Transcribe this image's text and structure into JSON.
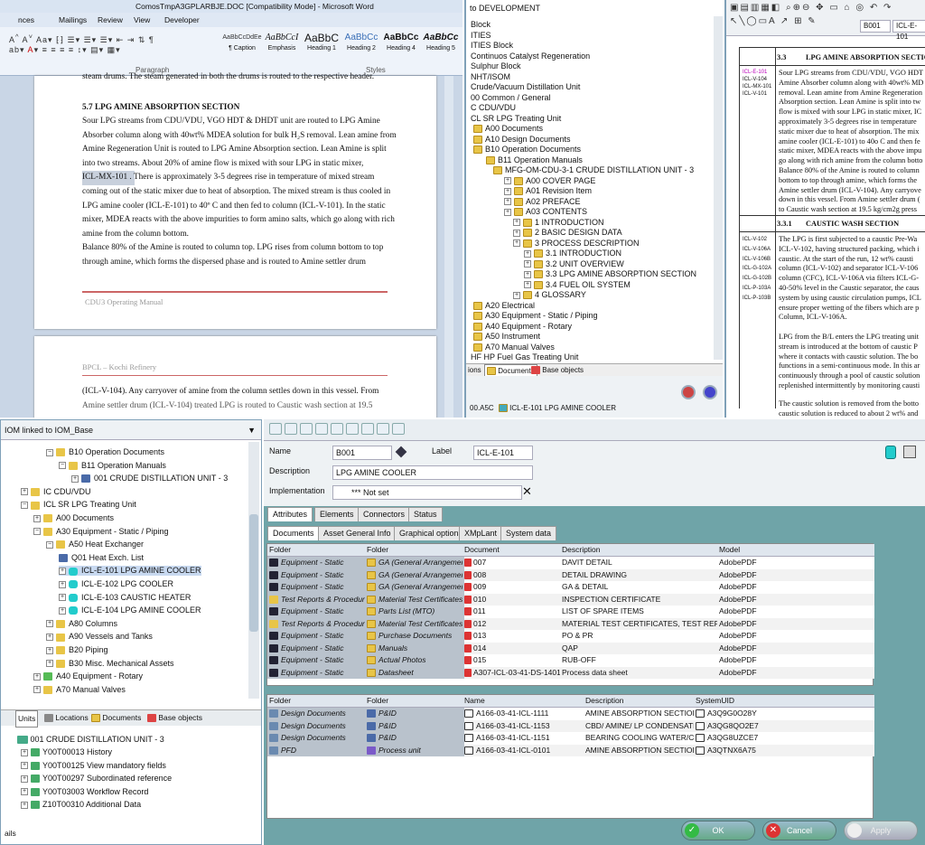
{
  "word": {
    "title": "ComosTmpA3GPLARBJE.DOC [Compatibility Mode] - Microsoft Word",
    "tabs": [
      "nces",
      "Mailings",
      "Review",
      "View",
      "Developer"
    ],
    "styles": [
      {
        "preview": "AaBbCcDdEe",
        "name": "¶ Caption"
      },
      {
        "preview": "AaBbCcI",
        "name": "Emphasis"
      },
      {
        "preview": "AaBbC",
        "name": "Heading 1"
      },
      {
        "preview": "AaBbCc",
        "name": "Heading 2"
      },
      {
        "preview": "AaBbCc",
        "name": "Heading 4"
      },
      {
        "preview": "AaBbCc",
        "name": "Heading 5"
      }
    ],
    "group_paragraph": "Paragraph",
    "group_styles": "Styles",
    "top_line": "steam drums. The steam generated in both the drums is routed to the respective header.",
    "heading": "5.7 LPG AMINE ABSORPTION SECTION",
    "body_lines": [
      "Sour LPG streams from CDU/VDU, VGO HDT & DHDT unit are routed to LPG Amine",
      "Absorber column along with 40wt% MDEA solution for bulk H₂S removal. Lean amine from",
      "Amine Regeneration Unit is routed to LPG Amine Absorption section. Lean Amine is split",
      "into two streams. About 20% of amine flow is mixed with sour LPG in static mixer,",
      "ICL-MX-101 . There is approximately 3-5 degrees rise in temperature of mixed stream",
      "coming out of the static mixer due to heat of absorption. The mixed stream is thus cooled in",
      "LPG amine cooler (ICL-E-101) to 40º C and then fed to column (ICL-V-101). In the static",
      "mixer, MDEA reacts with the above impurities to form amino salts, which go along with rich",
      "amine from the column bottom.",
      "Balance 80% of the Amine is routed to column top. LPG rises from column bottom to top",
      "through amine, which forms the dispersed phase and is routed to Amine settler drum"
    ],
    "footer": "CDU3 Operating Manual",
    "page2_header": "BPCL – Kochi Refinery",
    "page2_line1": "(ICL-V-104). Any carryover of amine from the column settles down in this vessel. From",
    "page2_line2": "Amine settler drum (ICL-V-104) treated LPG is routed to Caustic wash section at 19.5"
  },
  "tree_top": {
    "title": "to DEVELOPMENT",
    "items": [
      "Block",
      "ITIES",
      "ITIES  Block",
      "Continuos Catalyst Regeneration",
      "Sulphur Block",
      "NHT/ISOM",
      "Crude/Vacuum Distillation Unit",
      "00   Common / General",
      "C    CDU/VDU",
      "CL   SR LPG Treating Unit",
      "A00   Documents",
      "A10   Design Documents",
      "B10   Operation Documents",
      "B11   Operation Manuals",
      "MFG-OM-CDU-3-1  CRUDE DISTILLATION UNIT - 3",
      "A00   COVER PAGE",
      "A01   Revision Item",
      "A02   PREFACE",
      "A03   CONTENTS",
      "1     INTRODUCTION",
      "2     BASIC DESIGN DATA",
      "3     PROCESS DESCRIPTION",
      "3.1   INTRODUCTION",
      "3.2   UNIT OVERVIEW",
      "3.3   LPG AMINE ABSORPTION SECTION",
      "3.4   FUEL OIL SYSTEM",
      "4     GLOSSARY",
      "A20   Electrical",
      "A30   Equipment - Static / Piping",
      "A40   Equipment - Rotary",
      "A50   Instrument",
      "A70   Manual Valves",
      "HF   HP Fuel Gas Treating Unit"
    ],
    "tabs": [
      "ions",
      "Documents",
      "Base objects"
    ],
    "status": "00.A5C",
    "status_item": "ICL-E-101 LPG AMINE COOLER"
  },
  "viewer": {
    "field1": "B001",
    "field2": "ICL-E-101",
    "sec1_num": "3.3",
    "sec1_title": "LPG AMINE ABSORPTION SECTION",
    "sec1_tags": [
      "ICL-E-101",
      "ICL-V-104",
      "ICL-MX-101",
      "ICL-V-101"
    ],
    "sec1_lines": [
      "Sour LPG streams from CDU/VDU, VGO HDT",
      "Amine Absorber column along with 40wt% MD",
      "removal. Lean amine from Amine Regeneration",
      "Absorption section. Lean Amine is split into tw",
      "flow is mixed with sour LPG in static mixer, IC",
      "approximately 3-5 degrees rise in temperature",
      "static mixer due to heat of absorption. The mix",
      "amine cooler (ICL-E-101) to 40o C and then fe",
      "static mixer, MDEA reacts with the above impu",
      "go along with rich amine from the column botto",
      "Balance 80% of the Amine is routed to column",
      "bottom to top through amine, which forms the",
      "Amine settler drum (ICL-V-104). Any carryove",
      "down in this vessel. From Amine settler drum (",
      "to Caustic wash section at 19.5 kg/cm2g press"
    ],
    "sec2_num": "3.3.1",
    "sec2_title": "CAUSTIC WASH SECTION",
    "sec2_tags": [
      "ICL-V-102",
      "ICL-V-106A",
      "ICL-V-106B",
      "ICL-G-102A",
      "ICL-G-102B",
      "ICL-P-103A",
      "ICL-P-103B"
    ],
    "sec2_lines": [
      "The LPG is first subjected to a caustic Pre-Wa",
      "ICL-V-102, having structured packing, which i",
      "caustic. At the start of the run, 12 wt% causti",
      "column (ICL-V-102) and separator ICL-V-106",
      "column (CFC), ICL-V-106A via filters ICL-G-",
      "40-50% level in the Caustic separator, the caus",
      "system by using caustic circulation pumps, ICL",
      "ensure proper wetting of the fibers which are p",
      "Column, ICL-V-106A."
    ],
    "para3": [
      "LPG from the B/L enters the LPG treating unit",
      "stream is introduced at the bottom of caustic P",
      "where it contacts with caustic solution. The bo",
      "functions in a semi-continuous mode. In this ar",
      "continuously through a pool of caustic solution",
      "replenished intermittently by monitoring causti"
    ],
    "para4": [
      "The caustic solution is removed from the botto",
      "caustic solution is reduced to about 2 wt% and"
    ]
  },
  "tree_bottom": {
    "title": "IOM   linked to IOM_Base",
    "items": [
      {
        "t": "B10   Operation Documents",
        "ind": 70,
        "e": "−",
        "i": "fold"
      },
      {
        "t": "B11   Operation Manuals",
        "ind": 84,
        "e": "−",
        "i": "fold"
      },
      {
        "t": "001   CRUDE DISTILLATION UNIT - 3",
        "ind": 98,
        "e": "+",
        "i": "doc"
      },
      {
        "t": "IC   CDU/VDU",
        "ind": 42,
        "e": "+",
        "i": "fold"
      },
      {
        "t": "ICL   SR LPG Treating Unit",
        "ind": 42,
        "e": "−",
        "i": "fold"
      },
      {
        "t": "A00   Documents",
        "ind": 56,
        "e": "+",
        "i": "fold"
      },
      {
        "t": "A30   Equipment - Static / Piping",
        "ind": 56,
        "e": "−",
        "i": "fold"
      },
      {
        "t": "A50   Heat Exchanger",
        "ind": 70,
        "e": "−",
        "i": "fold"
      },
      {
        "t": "Q01   Heat Exch. List",
        "ind": 84,
        "e": "",
        "i": "doc"
      },
      {
        "t": "ICL-E-101   LPG AMINE COOLER",
        "ind": 84,
        "e": "+",
        "i": "eq"
      },
      {
        "t": "ICL-E-102   LPG COOLER",
        "ind": 84,
        "e": "+",
        "i": "eq"
      },
      {
        "t": "ICL-E-103   CAUSTIC HEATER",
        "ind": 84,
        "e": "+",
        "i": "eq"
      },
      {
        "t": "ICL-E-104   LPG AMINE COOLER",
        "ind": 84,
        "e": "+",
        "i": "eq"
      },
      {
        "t": "A80   Columns",
        "ind": 70,
        "e": "+",
        "i": "fold"
      },
      {
        "t": "A90   Vessels and Tanks",
        "ind": 70,
        "e": "+",
        "i": "fold"
      },
      {
        "t": "B20   Piping",
        "ind": 70,
        "e": "+",
        "i": "fold"
      },
      {
        "t": "B30   Misc. Mechanical Assets",
        "ind": 70,
        "e": "+",
        "i": "fold"
      },
      {
        "t": "A40   Equipment - Rotary",
        "ind": 56,
        "e": "+",
        "i": "rot"
      },
      {
        "t": "A70   Manual Valves",
        "ind": 56,
        "e": "+",
        "i": "fold"
      }
    ],
    "tabs": [
      "Units",
      "Locations",
      "Documents",
      "Base objects"
    ],
    "props_title": "001  CRUDE DISTILLATION UNIT - 3",
    "props": [
      "Y00T00013   History",
      "Y00T00125   View mandatory fields",
      "Y00T00297   Subordinated reference",
      "Y00T03003   Workflow Record",
      "Z10T00310   Additional Data"
    ],
    "bottom_tab": "ails"
  },
  "props": {
    "name_label": "Name",
    "name_value": "B001",
    "label_label": "Label",
    "label_value": "ICL-E-101",
    "desc_label": "Description",
    "desc_value": "LPG AMINE COOLER",
    "impl_label": "Implementation",
    "impl_value": "*** Not set",
    "tabs1": [
      "Attributes",
      "Elements",
      "Connectors",
      "Status"
    ],
    "tabs2": [
      "Documents",
      "Asset General Info",
      "Graphical options",
      "XMpLant",
      "System data"
    ],
    "grid1_headers": [
      "Folder",
      "Folder",
      "Document",
      "Description",
      "Model"
    ],
    "grid1_rows": [
      [
        "Equipment - Static",
        "GA (General Arrangement)",
        "007",
        "DAVIT DETAIL",
        "AdobePDF"
      ],
      [
        "Equipment - Static",
        "GA (General Arrangement)",
        "008",
        "DETAIL DRAWING",
        "AdobePDF"
      ],
      [
        "Equipment - Static",
        "GA (General Arrangement)",
        "009",
        "GA & DETAIL",
        "AdobePDF"
      ],
      [
        "Test Reports & Procedures",
        "Material Test Certificates",
        "010",
        "INSPECTION CERTIFICATE",
        "AdobePDF"
      ],
      [
        "Equipment - Static",
        "Parts List (MTO)",
        "011",
        "LIST OF SPARE ITEMS",
        "AdobePDF"
      ],
      [
        "Test Reports & Procedures",
        "Material Test Certificates",
        "012",
        "MATERIAL TEST CERTIFICATES, TEST REPORTS",
        "AdobePDF"
      ],
      [
        "Equipment - Static",
        "Purchase Documents",
        "013",
        "PO & PR",
        "AdobePDF"
      ],
      [
        "Equipment - Static",
        "Manuals",
        "014",
        "QAP",
        "AdobePDF"
      ],
      [
        "Equipment - Static",
        "Actual Photos",
        "015",
        "RUB-OFF",
        "AdobePDF"
      ],
      [
        "Equipment - Static",
        "Datasheet",
        "A307-ICL-03-41-DS-1401",
        "Process data sheet",
        "AdobePDF"
      ]
    ],
    "grid2_headers": [
      "Folder",
      "Folder",
      "Name",
      "Description",
      "SystemUID"
    ],
    "grid2_rows": [
      [
        "Design Documents",
        "P&ID",
        "A166-03-41-ICL-1111",
        "AMINE ABSORPTION SECTION",
        "A3Q9G0O28Y"
      ],
      [
        "Design Documents",
        "P&ID",
        "A166-03-41-ICL-1153",
        "CBD/ AMINE/ LP CONDENSATE",
        "A3QG8QO2E7"
      ],
      [
        "Design Documents",
        "P&ID",
        "A166-03-41-ICL-1151",
        "BEARING COOLING WATER/COOLING",
        "A3QG8UZCE7"
      ],
      [
        "PFD",
        "Process unit",
        "A166-03-41-ICL-0101",
        "AMINE ABSORPTION SECTION",
        "A3QTNX6A75"
      ]
    ],
    "ok": "OK",
    "cancel": "Cancel",
    "apply": "Apply"
  }
}
